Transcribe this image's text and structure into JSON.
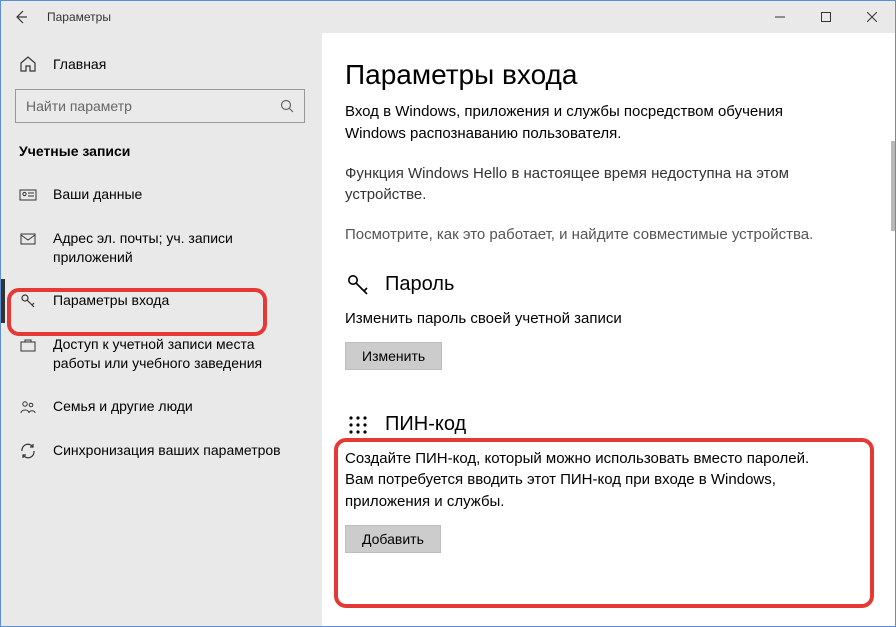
{
  "window": {
    "title": "Параметры"
  },
  "sidebar": {
    "home_label": "Главная",
    "search_placeholder": "Найти параметр",
    "section_label": "Учетные записи",
    "items": [
      {
        "label": "Ваши данные"
      },
      {
        "label": "Адрес эл. почты; уч. записи приложений"
      },
      {
        "label": "Параметры входа"
      },
      {
        "label": "Доступ к учетной записи места работы или учебного заведения"
      },
      {
        "label": "Семья и другие люди"
      },
      {
        "label": "Синхронизация ваших параметров"
      }
    ]
  },
  "content": {
    "title": "Параметры входа",
    "intro": "Вход в Windows, приложения и службы посредством обучения Windows распознаванию пользователя.",
    "hello_unavailable": "Функция Windows Hello в настоящее время недоступна на этом устройстве.",
    "learn_link": "Посмотрите, как это работает, и найдите совместимые устройства.",
    "password": {
      "title": "Пароль",
      "desc": "Изменить пароль своей учетной записи",
      "button": "Изменить"
    },
    "pin": {
      "title": "ПИН-код",
      "desc": "Создайте ПИН-код, который можно использовать вместо паролей. Вам потребуется вводить этот ПИН-код при входе в Windows, приложения и службы.",
      "button": "Добавить"
    }
  }
}
